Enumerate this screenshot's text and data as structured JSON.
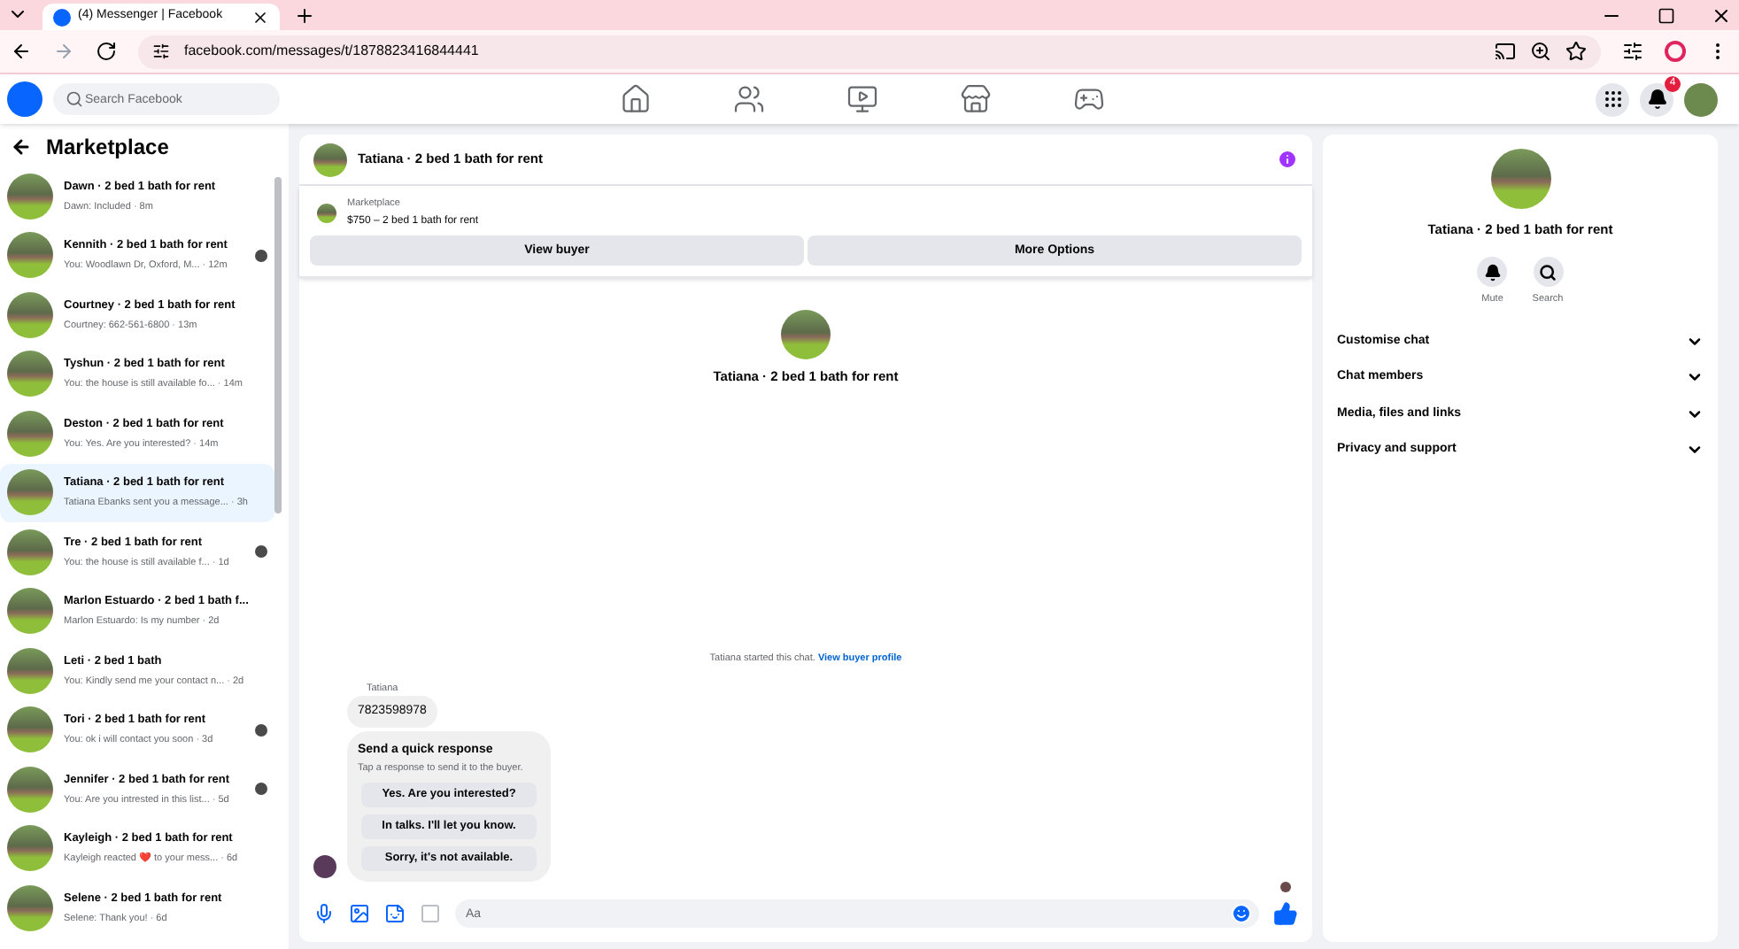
{
  "browser": {
    "tab_title": "(4) Messenger | Facebook",
    "url": "facebook.com/messages/t/1878823416844441"
  },
  "header": {
    "search_placeholder": "Search Facebook",
    "notifications_badge": "4"
  },
  "sidebar": {
    "title": "Marketplace",
    "conversations": [
      {
        "title": "Dawn · 2 bed 1 bath for rent",
        "preview": "Dawn: Included · 8m",
        "seen": false,
        "selected": false
      },
      {
        "title": "Kennith · 2 bed 1 bath for rent",
        "preview": "You: Woodlawn Dr, Oxford, M... · 12m",
        "seen": true,
        "selected": false
      },
      {
        "title": "Courtney · 2 bed 1 bath for rent",
        "preview": "Courtney: 662-561-6800 · 13m",
        "seen": false,
        "selected": false
      },
      {
        "title": "Tyshun · 2 bed 1 bath for rent",
        "preview": "You: the house is still available fo... · 14m",
        "seen": false,
        "selected": false
      },
      {
        "title": "Deston · 2 bed 1 bath for rent",
        "preview": "You: Yes. Are you interested? · 14m",
        "seen": false,
        "selected": false
      },
      {
        "title": "Tatiana · 2 bed 1 bath for rent",
        "preview": "Tatiana Ebanks sent you a message... · 3h",
        "seen": false,
        "selected": true
      },
      {
        "title": "Tre · 2 bed 1 bath for rent",
        "preview": "You: the house is still available f... · 1d",
        "seen": true,
        "selected": false
      },
      {
        "title": "Marlon Estuardo · 2 bed 1 bath f...",
        "preview": "Marlon Estuardo: Is my number · 2d",
        "seen": false,
        "selected": false
      },
      {
        "title": "Leti · 2 bed 1 bath",
        "preview": "You: Kindly send me your contact n... · 2d",
        "seen": false,
        "selected": false
      },
      {
        "title": "Tori · 2 bed 1 bath for rent",
        "preview": "You: ok i will contact you soon · 3d",
        "seen": true,
        "selected": false
      },
      {
        "title": "Jennifer · 2 bed 1 bath for rent",
        "preview": "You: Are you intrested in this list... · 5d",
        "seen": true,
        "selected": false
      },
      {
        "title": "Kayleigh · 2 bed 1 bath for rent",
        "preview": "Kayleigh reacted ❤️ to your mess... · 6d",
        "seen": false,
        "selected": false
      },
      {
        "title": "Selene · 2 bed 1 bath for rent",
        "preview": "Selene: Thank you! · 6d",
        "seen": false,
        "selected": false
      }
    ]
  },
  "chat": {
    "title": "Tatiana · 2 bed 1 bath for rent",
    "listing_label": "Marketplace",
    "listing": "$750 – 2 bed 1 bath for rent",
    "buttons": [
      "View buyer",
      "More Options"
    ],
    "intro_title": "Tatiana · 2 bed 1 bath for rent",
    "started_text": "Tatiana started this chat.",
    "started_link": "View buyer profile",
    "sender": "Tatiana",
    "message": "7823598978",
    "quick_title": "Send a quick response",
    "quick_hint": "Tap a response to send it to the buyer.",
    "quick_replies": [
      "Yes. Are you interested?",
      "In talks. I'll let you know.",
      "Sorry, it's not available."
    ],
    "composer_placeholder": "Aa"
  },
  "details": {
    "title": "Tatiana · 2 bed 1 bath for rent",
    "actions": [
      "Mute",
      "Search"
    ],
    "sections": [
      "Customise chat",
      "Chat members",
      "Media, files and links",
      "Privacy and support"
    ]
  }
}
